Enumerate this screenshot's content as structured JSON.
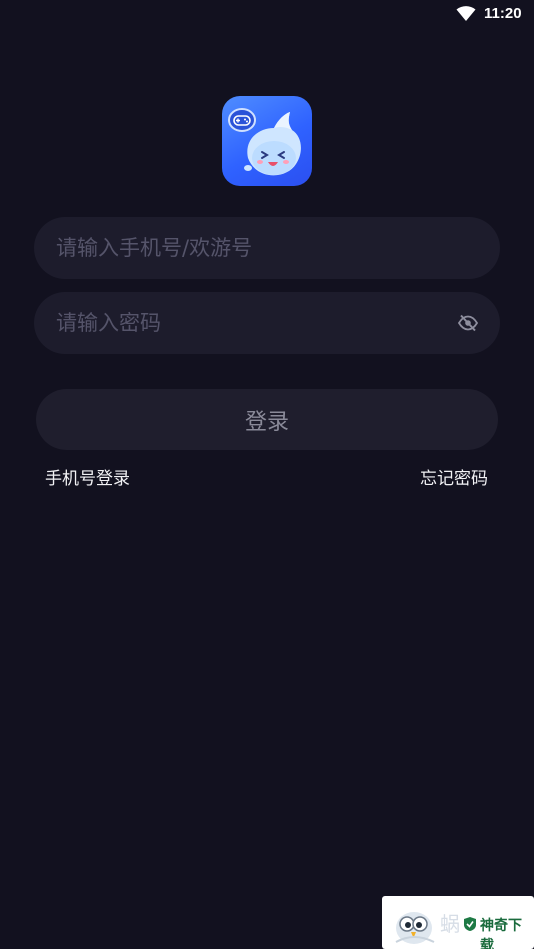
{
  "status_bar": {
    "time": "11:20"
  },
  "login_form": {
    "account_placeholder": "请输入手机号/欢游号",
    "account_value": "",
    "password_placeholder": "请输入密码",
    "password_value": "",
    "submit_label": "登录"
  },
  "links": {
    "phone_login": "手机号登录",
    "forgot_password": "忘记密码"
  },
  "watermark": {
    "faint_text": "蜗",
    "brand_text": "神奇下载"
  },
  "colors": {
    "background": "#12111f",
    "field_background": "#1d1c2c",
    "button_background": "#1f1e2d",
    "logo_gradient": "#2f62ff"
  },
  "icons": [
    "wifi-icon",
    "app-logo-icon",
    "eye-off-icon",
    "watermark-bird-icon"
  ]
}
